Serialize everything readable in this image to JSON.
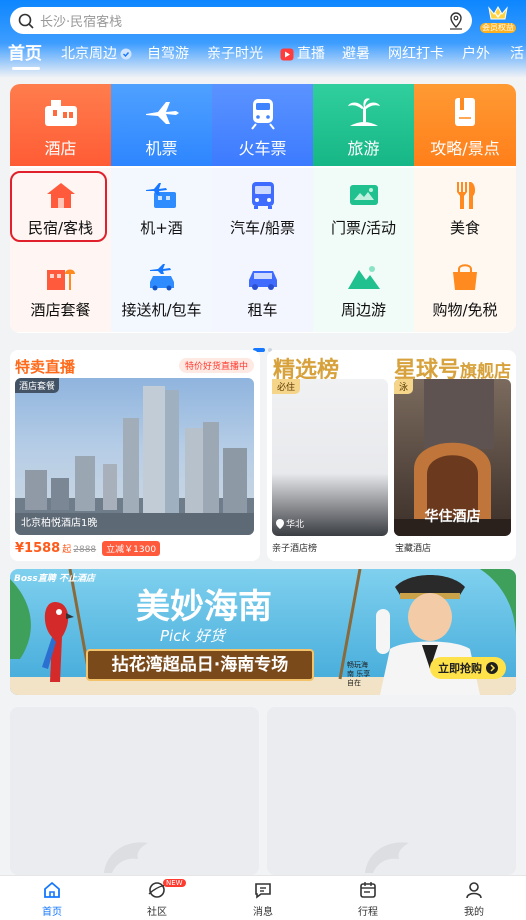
{
  "search": {
    "placeholder": "长沙·民宿客栈",
    "location_icon": "map-pin-icon"
  },
  "member": {
    "label": "会员权益"
  },
  "tabs": [
    {
      "label": "首页"
    },
    {
      "label": "北京周边"
    },
    {
      "label": "自驾游"
    },
    {
      "label": "亲子时光"
    },
    {
      "label": "直播"
    },
    {
      "label": "避暑"
    },
    {
      "label": "网红打卡"
    },
    {
      "label": "户外"
    },
    {
      "label": "活"
    }
  ],
  "grid_top": [
    {
      "label": "酒店",
      "color": "#ff6b3d"
    },
    {
      "label": "机票",
      "color": "#2f8cff"
    },
    {
      "label": "火车票",
      "color": "#3f83ff"
    },
    {
      "label": "旅游",
      "color": "#20c08f"
    },
    {
      "label": "攻略/景点",
      "color": "#ff8a1f"
    }
  ],
  "grid_row2": [
    {
      "label": "民宿/客栈"
    },
    {
      "label": "机+酒"
    },
    {
      "label": "汽车/船票"
    },
    {
      "label": "门票/活动"
    },
    {
      "label": "美食"
    }
  ],
  "grid_row3": [
    {
      "label": "酒店套餐"
    },
    {
      "label": "接送机/包车"
    },
    {
      "label": "租车"
    },
    {
      "label": "周边游"
    },
    {
      "label": "购物/免税"
    }
  ],
  "live": {
    "title": "特卖直播",
    "badge": "特价好货直播中",
    "tag": "酒店套餐",
    "hotel": "北京柏悦酒店1晚",
    "price": "¥1588",
    "price_suffix": "起",
    "orig_price": "2888",
    "discount": "立减￥1300"
  },
  "ranking": {
    "title": "精选榜",
    "tag": "必住",
    "location": "华北",
    "caption": "亲子酒店榜"
  },
  "star": {
    "title": "星球号",
    "title_suffix": "旗舰店",
    "tag": "泳",
    "hotel": "华住酒店",
    "caption": "宝藏酒店"
  },
  "banner": {
    "brand": "Boss直聘 不止酒店",
    "title": "美妙海南",
    "subtitle": "Pick 好货",
    "slogan": "拈花湾超品日·海南专场",
    "stamp": "畅玩海南 乐享自在",
    "cta": "立即抢购"
  },
  "bottom_nav": [
    {
      "label": "首页",
      "active": true
    },
    {
      "label": "社区",
      "badge": "NEW"
    },
    {
      "label": "消息"
    },
    {
      "label": "行程"
    },
    {
      "label": "我的"
    }
  ],
  "colors": {
    "accent": "#1677ff",
    "live_orange": "#ff6a1a",
    "rank_gold": "#d7a23c"
  }
}
